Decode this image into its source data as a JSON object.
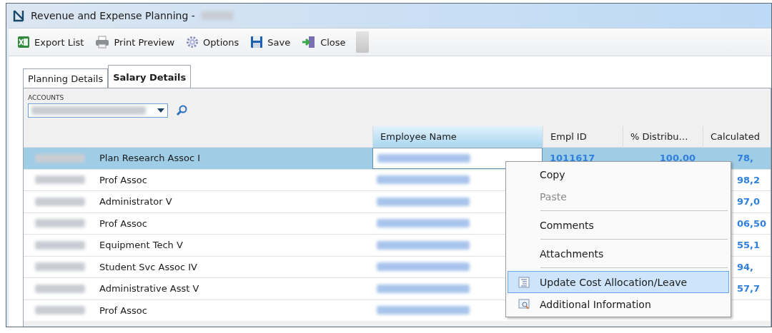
{
  "window": {
    "title": "Revenue and Expense Planning -"
  },
  "toolbar": [
    {
      "label": "Export List",
      "kind": "excel"
    },
    {
      "label": "Print Preview",
      "kind": "printer"
    },
    {
      "label": "Options",
      "kind": "gear"
    },
    {
      "label": "Save",
      "kind": "disk"
    },
    {
      "label": "Close",
      "kind": "exit"
    }
  ],
  "tabs": [
    {
      "label": "Planning Details",
      "selected": false
    },
    {
      "label": "Salary Details",
      "selected": true
    }
  ],
  "accounts": {
    "label": "ACCOUNTS"
  },
  "table": {
    "columns": [
      "Employee Name",
      "Empl ID",
      "% Distribu…",
      "Calculated"
    ],
    "rows": [
      {
        "title": "Plan Research Assoc I",
        "empl_id": "1011617",
        "distribution": "100.00",
        "calculated": "78,",
        "selected": true
      },
      {
        "title": "Prof Assoc",
        "calculated": "98,2",
        "selected": false
      },
      {
        "title": "Administrator V",
        "calculated": "97,0",
        "selected": false
      },
      {
        "title": "Prof Assoc",
        "calculated": "06,50",
        "selected": false
      },
      {
        "title": "Equipment Tech V",
        "calculated": "55,1",
        "selected": false
      },
      {
        "title": "Student Svc Assoc IV",
        "calculated": "94,",
        "selected": false
      },
      {
        "title": "Administrative Asst V",
        "calculated": "57,7",
        "selected": false
      },
      {
        "title": "Prof Assoc",
        "selected": false
      }
    ]
  },
  "context_menu": [
    {
      "label": "Copy",
      "disabled": false,
      "selected": false,
      "kind": "item"
    },
    {
      "label": "Paste",
      "disabled": true,
      "selected": false,
      "kind": "item"
    },
    {
      "kind": "separator"
    },
    {
      "label": "Comments",
      "disabled": false,
      "selected": false,
      "kind": "item"
    },
    {
      "kind": "separator"
    },
    {
      "label": "Attachments",
      "disabled": false,
      "selected": false,
      "kind": "item"
    },
    {
      "kind": "separator"
    },
    {
      "label": "Update Cost Allocation/Leave",
      "disabled": false,
      "selected": true,
      "kind": "listitem"
    },
    {
      "label": "Additional Information",
      "disabled": false,
      "selected": false,
      "kind": "lensitem"
    }
  ]
}
